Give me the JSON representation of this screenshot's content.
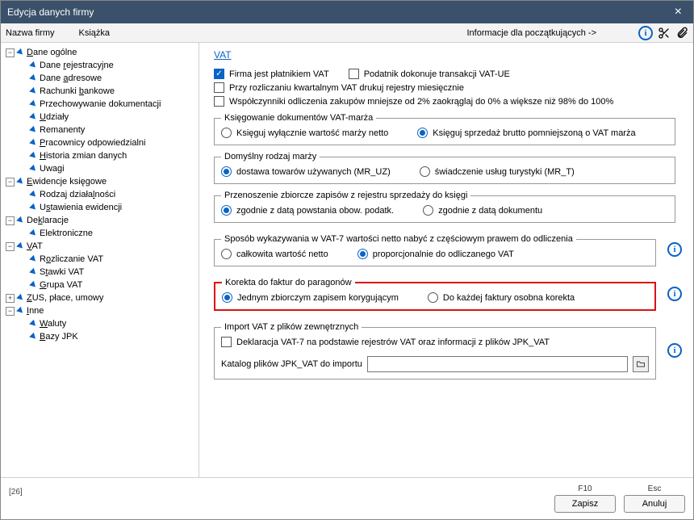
{
  "window": {
    "title": "Edycja danych firmy"
  },
  "menubar": {
    "company": "Nazwa firmy",
    "book": "Książka",
    "beginners": "Informacje dla początkujących ->"
  },
  "tree": {
    "n0": "Dane ogólne",
    "n0_0": "Dane rejestracyjne",
    "n0_1": "Dane adresowe",
    "n0_2": "Rachunki bankowe",
    "n0_3": "Przechowywanie dokumentacji",
    "n0_4": "Udziały",
    "n0_5": "Remanenty",
    "n0_6": "Pracownicy odpowiedzialni",
    "n0_7": "Historia zmian danych",
    "n0_8": "Uwagi",
    "n1": "Ewidencje księgowe",
    "n1_0": "Rodzaj działalności",
    "n1_1": "Ustawienia ewidencji",
    "n2": "Deklaracje",
    "n2_0": "Elektroniczne",
    "n3": "VAT",
    "n3_0": "Rozliczanie VAT",
    "n3_1": "Stawki VAT",
    "n3_2": "Grupa VAT",
    "n4": "ZUS, płace, umowy",
    "n5": "Inne",
    "n5_0": "Waluty",
    "n5_1": "Bazy JPK"
  },
  "page": {
    "heading": "VAT",
    "cb_payer": "Firma jest płatnikiem VAT",
    "cb_ue": "Podatnik dokonuje transakcji VAT-UE",
    "cb_quarterly": "Przy rozliczaniu kwartalnym VAT drukuj rejestry miesięcznie",
    "cb_coeff": "Współczynniki odliczenia zakupów  mniejsze od 2% zaokrąglaj do 0% a większe niż  98% do 100%",
    "g_marza": {
      "legend": "Księgowanie dokumentów VAT-marża",
      "opt1": "Księguj wyłącznie wartość marży netto",
      "opt2": "Księguj sprzedaż brutto pomniejszoną o VAT marża"
    },
    "g_rodzaj": {
      "legend": "Domyślny rodzaj marży",
      "opt1": "dostawa towarów używanych (MR_UZ)",
      "opt2": "świadczenie usług turystyki (MR_T)"
    },
    "g_przen": {
      "legend": "Przenoszenie zbiorcze zapisów z rejestru sprzedaży do księgi",
      "opt1": "zgodnie z datą powstania obow. podatk.",
      "opt2": "zgodnie z datą dokumentu"
    },
    "g_vat7": {
      "legend": "Sposób wykazywania w VAT-7 wartości netto nabyć z częściowym prawem do odliczenia",
      "opt1": "całkowita wartość netto",
      "opt2": "proporcjonalnie do odliczanego VAT"
    },
    "g_korekta": {
      "legend": "Korekta do faktur do paragonów",
      "opt1": "Jednym zbiorczym zapisem korygującym",
      "opt2": "Do każdej faktury osobna korekta"
    },
    "g_import": {
      "legend": "Import VAT z plików zewnętrznych",
      "cb": "Deklaracja VAT-7 na podstawie rejestrów VAT oraz informacji z plików JPK_VAT",
      "path_label": "Katalog plików JPK_VAT do importu",
      "path_value": ""
    }
  },
  "footer": {
    "corner": "[26]",
    "key_save": "F10",
    "key_cancel": "Esc",
    "btn_save": "Zapisz",
    "btn_cancel": "Anuluj"
  }
}
